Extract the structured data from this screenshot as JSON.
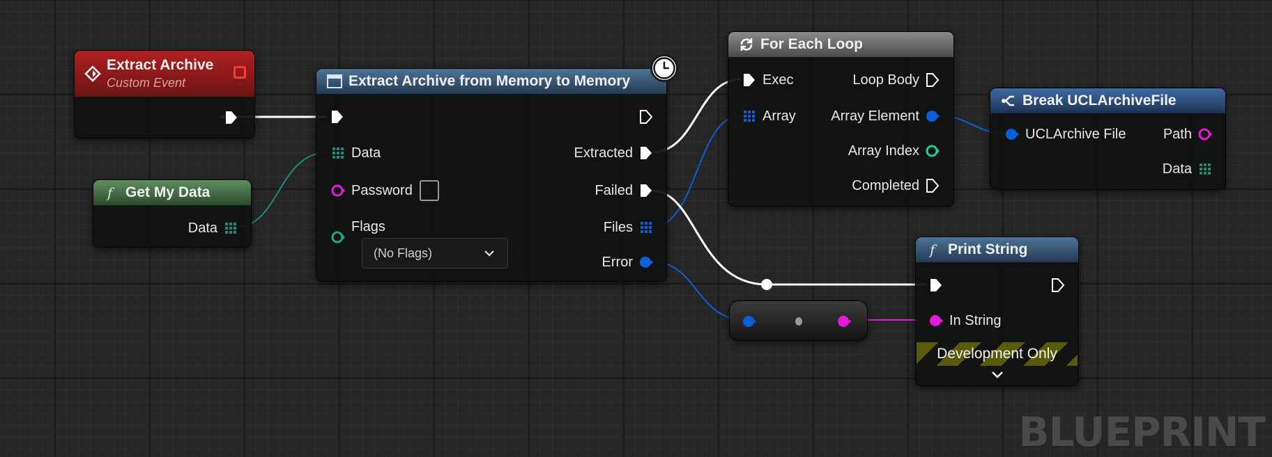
{
  "colors": {
    "exec": "#ffffff",
    "byte_array": "#1f8a78",
    "struct": "#0b5fd9",
    "string": "#e61ad9",
    "integer": "#1fcfa0",
    "enum": "#1fa88e",
    "event_header": "#9a1f1f",
    "pure_header": "#4a7a4a",
    "function_header": "#3a5c7c",
    "loop_header": "#6a6a6a",
    "break_header": "#2c4f80"
  },
  "nodes": {
    "extract_archive_event": {
      "title": "Extract Archive",
      "subtitle": "Custom Event",
      "icon": "custom-event-diamond-icon"
    },
    "get_my_data": {
      "title": "Get My Data",
      "icon": "function-f-icon",
      "outputs": {
        "data": "Data"
      }
    },
    "extract_from_memory": {
      "title": "Extract Archive from Memory to Memory",
      "icon": "function-library-icon",
      "latent_icon": "clock-icon",
      "inputs": {
        "data": "Data",
        "password": "Password",
        "flags": "Flags"
      },
      "flags_value": "(No Flags)",
      "outputs": {
        "extracted": "Extracted",
        "failed": "Failed",
        "files": "Files",
        "error": "Error"
      }
    },
    "for_each_loop": {
      "title": "For Each Loop",
      "icon": "loop-arrows-icon",
      "inputs": {
        "exec": "Exec",
        "array": "Array"
      },
      "outputs": {
        "loop_body": "Loop Body",
        "array_element": "Array Element",
        "array_index": "Array Index",
        "completed": "Completed"
      }
    },
    "break_struct": {
      "title": "Break UCLArchiveFile",
      "icon": "break-struct-icon",
      "inputs": {
        "archive_file": "UCLArchive File"
      },
      "outputs": {
        "path": "Path",
        "data": "Data"
      }
    },
    "print_string": {
      "title": "Print String",
      "icon": "function-f-icon",
      "inputs": {
        "in_string": "In String"
      },
      "development_only": "Development Only",
      "expand_icon": "chevron-down-icon"
    },
    "conversion": {
      "icon": "conversion-dot-icon"
    }
  },
  "watermark": "BLUEPRINT"
}
